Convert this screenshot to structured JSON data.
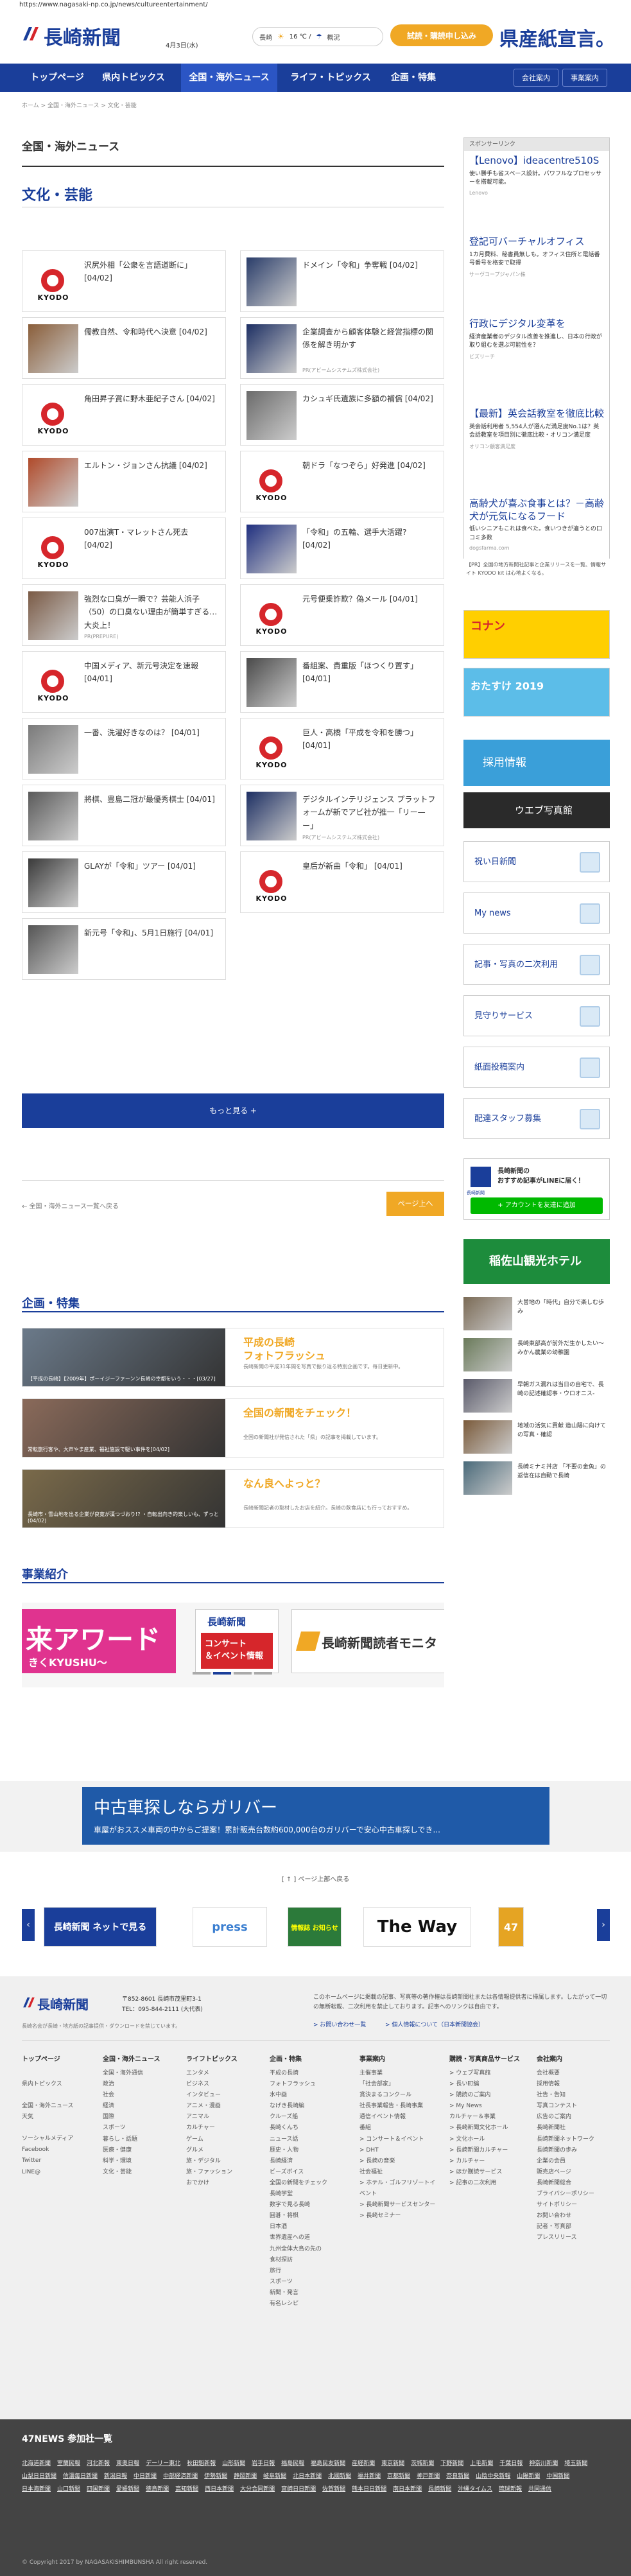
{
  "browser": {
    "url": "https://www.nagasaki-np.co.jp/news/cultureentertainment/"
  },
  "header": {
    "logo_text": "長崎新聞",
    "date": "4月3日(水)",
    "weather": {
      "city": "長崎",
      "temp": "16 ℃ /",
      "link": "概況"
    },
    "trial_button": "試読・購読申し込み",
    "slogan": "県産紙宣言。"
  },
  "nav": {
    "items": [
      "トップページ",
      "県内トピックス",
      "全国・海外ニュース",
      "ライフ・トピックス",
      "企画・特集"
    ],
    "active": 2,
    "right": [
      "会社案内",
      "事業案内"
    ]
  },
  "breadcrumb": "ホーム > 全国・海外ニュース > 文化・芸能",
  "section_title": "全国・海外ニュース",
  "category_title": "文化・芸能",
  "articles": [
    {
      "title": "沢尻外相「公衆を言語道断に」 [04/02]",
      "kind": "kyodo"
    },
    {
      "title": "ドメイン「令和」争奪戦 [04/02]",
      "kind": "photo",
      "tone": "#2a3d6a"
    },
    {
      "title": "儒教自然、令和時代へ決意 [04/02]",
      "kind": "photo",
      "tone": "#8a5e3a"
    },
    {
      "title": "企業調査から顧客体験と経営指標の関係を解き明かす",
      "kind": "photo",
      "tone": "#1d2f63",
      "pr": "PR(アビームシステムズ株式会社)"
    },
    {
      "title": "角田昇子賞に野木亜紀子さん [04/02]",
      "kind": "kyodo"
    },
    {
      "title": "カシュギ氏遺族に多額の補償 [04/02]",
      "kind": "photo",
      "tone": "#6b6b6b"
    },
    {
      "title": "エルトン・ジョンさん抗議 [04/02]",
      "kind": "photo",
      "tone": "#b04a2a"
    },
    {
      "title": "朝ドラ「なつぞら」好発進 [04/02]",
      "kind": "kyodo"
    },
    {
      "title": "007出演T・マレットさん死去 [04/02]",
      "kind": "kyodo"
    },
    {
      "title": "「令和」の五輪、選手大活躍? [04/02]",
      "kind": "photo",
      "tone": "#203080"
    },
    {
      "title": "強烈な口臭が一瞬で？芸能人浜子（50）の口臭ない理由が簡単すぎる…大炎上！",
      "kind": "photo",
      "tone": "#7a5a45",
      "pr": "PR(PREPURE)"
    },
    {
      "title": "元号便乗詐欺？偽メール [04/01]",
      "kind": "kyodo"
    },
    {
      "title": "中国メディア、新元号決定を速報 [04/01]",
      "kind": "kyodo"
    },
    {
      "title": "番組案、貴重版「ほつくり置す」 [04/01]",
      "kind": "photo",
      "tone": "#4a4a4a"
    },
    {
      "title": "一番、洗濯好きなのは？ [04/01]",
      "kind": "photo",
      "tone": "#7a7a7a"
    },
    {
      "title": "巨人・高橋「平成を令和を勝つ」 [04/01]",
      "kind": "kyodo"
    },
    {
      "title": "將棋、豊島二冠が最優秀棋士 [04/01]",
      "kind": "photo",
      "tone": "#5a5a5a"
    },
    {
      "title": "デジタルインテリジェンス プラットフォームが新でアビ社が推一「リー—ー」",
      "kind": "photo",
      "tone": "#1d2f63",
      "pr": "PR(アビームシステムズ株式会社)"
    },
    {
      "title": "GLAYが「令和」ツアー [04/01]",
      "kind": "photo",
      "tone": "#3a3a3a"
    },
    {
      "title": "皇后が新曲「令和」 [04/01]",
      "kind": "kyodo"
    },
    {
      "title": "新元号「令和」、5月1日施行 [04/01]",
      "kind": "photo",
      "tone": "#555"
    }
  ],
  "more_button": "もっと見る +",
  "back_link": "← 全国・海外ニュース一覧へ戻る",
  "page_top": "ページ上へ",
  "features": {
    "title": "企画・特集",
    "items": [
      {
        "title": "平成の長崎\nフォトフラッシュ",
        "desc": "長崎新聞の平成31年間を写真で振り返る特別企画です。毎日更新中。",
        "caption": "【平成の長崎】【2009年】ポーイジーファーンン長崎の幸都をいう・・・[03/27]"
      },
      {
        "title": "全国の新聞をチェック！",
        "desc": "全国の新聞社が発信された「県」の記事を掲載しています。",
        "caption": "常転旅行客や、大声やま産業、福祉施設で駆い事件を[04/02]"
      },
      {
        "title": "なん良へよっと？",
        "desc": "長崎新聞記者の取材したお店を紹介。長崎の飲食店にも行っておすすめ。",
        "caption": "長崎市・雪山地を出る企業が良寛が漢つづおり!? ・自転出向き的楽しいも、ずっと(04/02)"
      }
    ]
  },
  "business": {
    "title": "事業紹介",
    "banner_left": "来アワード",
    "banner_left_sub": "きくKYUSHU～",
    "banner_mid_logo": "長崎新聞",
    "banner_mid_sub": "コンサート\n＆イベント情報",
    "banner_right": "長崎新聞読者モニタ"
  },
  "ad": {
    "title": "中古車探しならガリバー",
    "sub": "車屋がおススメ車両の中からご提案！累計販売台数約600,000台のガリバーで安心中古車探しでき..."
  },
  "pagetop_link": "[ ↑ ] ページ上部へ戻る",
  "carousel": [
    "長崎新聞 ネットで見る",
    "press",
    "情報誌 お知らせ",
    "The Way",
    "47"
  ],
  "footer": {
    "logo": "長崎新聞",
    "address": "〒852-8601  長崎市茂里町3-1\nTEL：095-844-2111 (大代表)",
    "note": "長崎名会が長崎・地方紙の記事提供・ダウンロードを禁じています。",
    "copyright_text": "このホームページに掲載の記事、写真等の著作権は長崎新聞社または各情報提供者に帰属します。したがって一切の無断転載、二次利用を禁止しております。記事へのリンクは自由です。",
    "links": [
      "> お問い合わせ一覧",
      "> 個人情報について（日本新聞協会）"
    ],
    "cols": [
      {
        "head": "トップページ",
        "items": [
          "",
          "県内トピックス",
          "",
          "全国・海外ニュース",
          "天気",
          "",
          "ソーシャルメディア",
          "Facebook",
          "Twitter",
          "LINE@"
        ]
      },
      {
        "head": "全国・海外ニュース",
        "items": [
          "全国・海外通信",
          "政治",
          "社会",
          "経済",
          "国際",
          "スポーツ",
          "暮らし・話題",
          "医療・健康",
          "科学・環境",
          "文化・芸能"
        ]
      },
      {
        "head": "ライフトピックス",
        "items": [
          "エンタメ",
          "ビジネス",
          "インタビュー",
          "アニメ・漫画",
          "アニマル",
          "カルチャー",
          "ゲーム",
          "グルメ",
          "旅・デジタル",
          "旅・ファッション",
          "おでかけ"
        ]
      },
      {
        "head": "企画・特集",
        "items": [
          "平成の長崎",
          "フォトフラッシュ",
          "水中画",
          "なげき長崎編",
          "クルーズ船",
          "長崎くんち",
          "ニュース話",
          "歴史・人物",
          "長崎経済",
          "ビーズボイス",
          "全国の新聞をチェック",
          "長崎学堂",
          "数字で見る長崎",
          "囲碁・将棋",
          "日本酒",
          "世界遺産への道",
          "九州全体大島の先の",
          "食材探訪",
          "旅行",
          "スポーツ",
          "新聞・発言",
          "有名レシピ"
        ]
      },
      {
        "head": "事業案内",
        "items": [
          "主催事業",
          "「社会部家」",
          "賞決まるコンクール",
          "社長事業報告・長崎事業",
          "通信イベント情報",
          "番組",
          "> コンサート＆イベント",
          "> DHT",
          "> 長崎の音楽",
          "社会福祉",
          "> ホテル・ゴルフリゾートイベント",
          "> 長崎新聞サービスセンター",
          "> 長崎セミナー"
        ]
      },
      {
        "head": "購読・写真商品サービス",
        "items": [
          "> ウェブ写真館",
          "> 長い町編",
          "> 購読のご案内",
          "> My News",
          "カルチャー＆事業",
          "> 長崎新聞文化ホール",
          "> 文化ホール",
          "> 長崎新聞カルチャー",
          "> カルチャー",
          "> ほか購読サービス",
          "> 記事の二次利用"
        ]
      },
      {
        "head": "会社案内",
        "items": [
          "会社概要",
          "採用情報",
          "社告・告知",
          "写真コンテスト",
          "広告のご案内",
          "長崎新聞社",
          "長崎新聞ネットワーク",
          "長崎新聞の歩み",
          "企業の会員",
          "販売店ページ",
          "長崎新聞総合",
          "ブライバシーポリシー",
          "サイトポリシー",
          "お問い合わせ",
          "記者・写真部",
          "プレスリリース"
        ]
      }
    ]
  },
  "bottom": {
    "title": "47NEWS 参加社一覧",
    "papers": [
      "北海道新聞",
      "室蘭民報",
      "河北新報",
      "東奥日報",
      "デーリー東北",
      "秋田魁新報",
      "山形新聞",
      "岩手日報",
      "福島民報",
      "福島民友新聞",
      "産経新聞",
      "東京新聞",
      "茨城新聞",
      "下野新聞",
      "上毛新聞",
      "千葉日報",
      "神奈川新聞",
      "埼玉新聞",
      "山梨日日新聞",
      "信濃毎日新聞",
      "新潟日報",
      "中日新聞",
      "中部経済新聞",
      "伊勢新聞",
      "静岡新聞",
      "岐阜新聞",
      "北日本新聞",
      "北國新聞",
      "福井新聞",
      "京都新聞",
      "神戸新聞",
      "奈良新聞",
      "山陰中央新報",
      "山陽新聞",
      "中国新聞",
      "日本海新聞",
      "山口新聞",
      "四国新聞",
      "愛媛新聞",
      "徳島新聞",
      "高知新聞",
      "西日本新聞",
      "大分合同新聞",
      "宮崎日日新聞",
      "佐賀新聞",
      "熊本日日新聞",
      "南日本新聞",
      "長崎新聞",
      "沖縄タイムス",
      "琉球新報",
      "共同通信"
    ],
    "copyright": "© Copyright 2017 by NAGASAKISHIMBUNSHA  All right reserved."
  },
  "sidebar": {
    "label": "スポンサーリンク",
    "ads": [
      {
        "title": "【Lenovo】ideacentre510S",
        "body": "使い勝手も省スペース設計。パワフルなプロセッサーを搭載可能。",
        "src": "Lenovo"
      },
      {
        "title": "登記可バーチャルオフィス",
        "body": "1カ月費料、秘書員無しも。オフィス住所と電話番号番号を格安で取得",
        "src": "サーヴコープジャパン株"
      },
      {
        "title": "行政にデジタル変革を",
        "body": "経済産業者のデジタル改善を推進し、日本の行政が取り組むを選ぶ可能性を？",
        "src": "ビズリーチ"
      },
      {
        "title": "【最新】英会話教室を徹底比較",
        "body": "英会話利用者 5,554人が選んだ満足度No.1は？英会話教室を項目別に徹底比較・オリコン満足度",
        "src": "オリコン顧客満足度"
      },
      {
        "title": "高齢犬が喜ぶ食事とは？－高齢犬が元気になるフード",
        "body": "低いシニアもこれは食べた。食いつきが違うとの口コミ多数",
        "src": "dogsfarma.com"
      }
    ],
    "kyodo_note": "【PR】全国の地方新聞社記事と企業リリースを一覧、情報サイト KYODO kit は心地よくなる。",
    "recruit": "採用情報",
    "webphoto": "ウエブ写真館",
    "buttons": [
      "祝い日新聞",
      "My news",
      "記事・写真の二次利用",
      "見守りサービス",
      "紙面投稿案内",
      "配達スタッフ募集"
    ],
    "line": {
      "logo": "長崎新聞",
      "text": "長崎新聞の\nおすすめ記事がLINEに届く！",
      "btn": "+ アカウントを友達に追加"
    },
    "hotel": "稲佐山観光ホテル",
    "news": [
      {
        "title": "大曽地の「時代」自分で楽しむ歩み",
        "tone": "#7a6a55"
      },
      {
        "title": "長崎東部高が前外だ生かしたい～みかん農業の幼稚園",
        "tone": "#6a7a5a"
      },
      {
        "title": "早朝ガス漏れは当日の自宅で、長崎の記述確認事・ウロオニス-",
        "tone": "#5a5a6a"
      },
      {
        "title": "地域の活気に貢献 造山陽に向けての写真・確認",
        "tone": "#7a5a3a"
      },
      {
        "title": "長崎ミナミ丼店 「不要の金魚」の返信在は自動で長崎",
        "tone": "#4a6a7a"
      }
    ]
  }
}
